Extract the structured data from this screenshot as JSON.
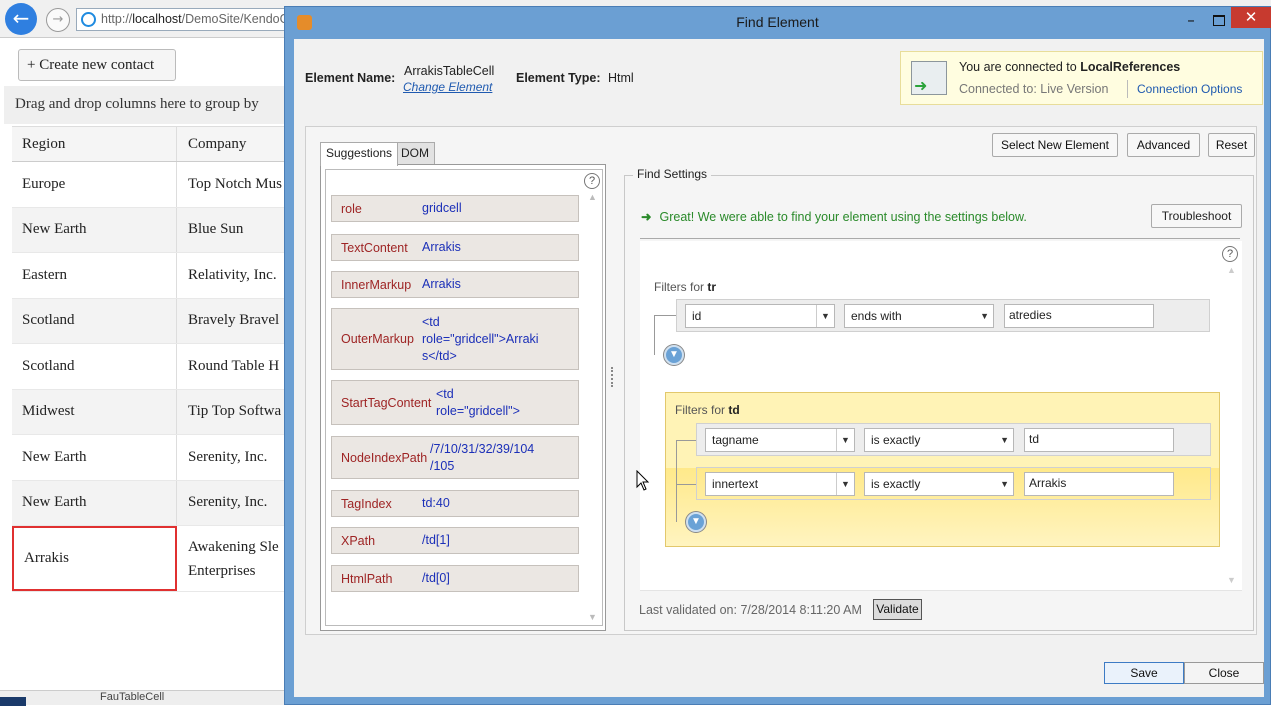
{
  "browser": {
    "address_prefix": "http://",
    "address_host": "localhost",
    "address_path": "/DemoSite/KendoG",
    "create_button": "+ Create new contact",
    "group_hint": "Drag and drop columns here to group by",
    "grid": {
      "headers": [
        "Region",
        "Company"
      ],
      "rows": [
        {
          "region": "Europe",
          "company": "Top Notch Mus"
        },
        {
          "region": "New Earth",
          "company": "Blue Sun"
        },
        {
          "region": "Eastern",
          "company": "Relativity, Inc."
        },
        {
          "region": "Scotland",
          "company": "Bravely Bravel"
        },
        {
          "region": "Scotland",
          "company": "Round Table H"
        },
        {
          "region": "Midwest",
          "company": "Tip Top Softwa"
        },
        {
          "region": "New Earth",
          "company": "Serenity, Inc."
        },
        {
          "region": "New Earth",
          "company": "Serenity, Inc."
        }
      ],
      "selected_row": {
        "region": "Arrakis",
        "company": "Awakening Sle Enterprises"
      }
    },
    "tree_text": "FauTableCell"
  },
  "dialog": {
    "title": "Find Element",
    "element_name_label": "Element Name:",
    "element_name": "ArrakisTableCell",
    "change_element": "Change Element",
    "element_type_label": "Element Type:",
    "element_type": "Html",
    "connection": {
      "line1_prefix": "You are connected to",
      "target": "LocalReferences",
      "line2": "Connected to:  Live Version",
      "options": "Connection Options"
    },
    "tabs": [
      "Suggestions",
      "DOM"
    ],
    "buttons": {
      "select_new": "Select New Element",
      "advanced": "Advanced",
      "reset": "Reset",
      "troubleshoot": "Troubleshoot",
      "validate": "Validate",
      "save": "Save",
      "close": "Close"
    },
    "suggestions": [
      {
        "key": "role",
        "value": "gridcell"
      },
      {
        "key": "TextContent",
        "value": "Arrakis"
      },
      {
        "key": "InnerMarkup",
        "value": "Arrakis"
      },
      {
        "key": "OuterMarkup",
        "value": "<td\nrole=\"gridcell\">Arraki\ns</td>"
      },
      {
        "key": "StartTagContent",
        "value": "<td\nrole=\"gridcell\">"
      },
      {
        "key": "NodeIndexPath",
        "value": "/7/10/31/32/39/104\n/105"
      },
      {
        "key": "TagIndex",
        "value": "td:40"
      },
      {
        "key": "XPath",
        "value": "/td[1]"
      },
      {
        "key": "HtmlPath",
        "value": "/td[0]"
      }
    ],
    "find_settings": {
      "legend": "Find Settings",
      "success": "Great! We were able to find your element using the settings below.",
      "filters_for_label": "Filters for",
      "groups": [
        {
          "tag": "tr",
          "filters": [
            {
              "attribute": "id",
              "operator": "ends with",
              "value": "atredies"
            }
          ]
        },
        {
          "tag": "td",
          "filters": [
            {
              "attribute": "tagname",
              "operator": "is exactly",
              "value": "td"
            },
            {
              "attribute": "innertext",
              "operator": "is exactly",
              "value": "Arrakis"
            }
          ]
        }
      ],
      "last_validated": "Last validated on: 7/28/2014 8:11:20 AM"
    }
  },
  "icons": {
    "back": "back-arrow-icon",
    "forward": "forward-arrow-icon",
    "browser": "ie-icon",
    "app": "app-icon",
    "connection": "connection-icon",
    "help": "help-icon",
    "add_filter": "add-filter-icon"
  },
  "colors": {
    "dialog_frame": "#6b9fd3",
    "close_button": "#c73a2f",
    "success_text": "#2a8a2a",
    "suggestion_key": "#9e2424",
    "suggestion_value": "#1b2fb8",
    "selected_cell_border": "#e03030",
    "td_filter_group": "#fff3b6"
  }
}
